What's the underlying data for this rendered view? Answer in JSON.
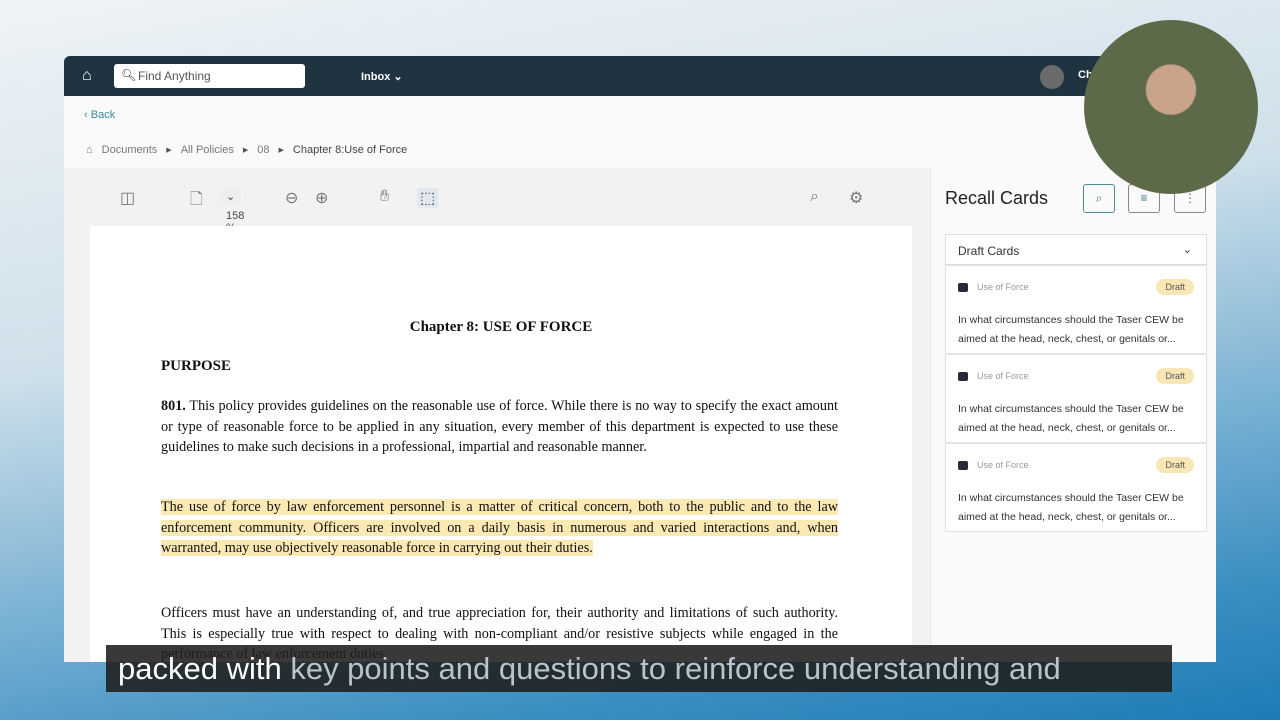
{
  "nav": {
    "search_placeholder": "Find Anything",
    "inbox": "Inbox",
    "user": "Ch"
  },
  "back": "Back",
  "breadcrumb": [
    "Documents",
    "All Policies",
    "08",
    "Chapter 8:Use of Force"
  ],
  "toolbar": {
    "zoom": "158 %"
  },
  "doc": {
    "title": "Chapter 8: USE OF FORCE",
    "heading": "PURPOSE",
    "p1_num": "801.",
    "p1": " This policy provides guidelines on the reasonable use of force. While there is no way to specify the exact amount or type of reasonable force to be applied in any situation, every member of this department is expected to use these guidelines to make such decisions in a professional, impartial and reasonable manner.",
    "p2": "The use of force by law enforcement personnel is a matter of critical concern, both to the public and to the law enforcement community. Officers are involved on a daily basis in numerous and varied interactions and, when warranted, may use objectively reasonable force in carrying out their duties.",
    "p3": "Officers must have an understanding of, and true appreciation for, their authority and limitations of such authority. This is especially true with respect to dealing with non-compliant and/or resistive subjects while engaged in the performance of law enforcement duties."
  },
  "side": {
    "title": "Recall Cards",
    "section": "Draft Cards",
    "cards": [
      {
        "tag": "Use of Force",
        "badge": "Draft",
        "q": "In what circumstances should the Taser CEW be aimed at the head, neck, chest, or genitals or..."
      },
      {
        "tag": "Use of Force",
        "badge": "Draft",
        "q": "In what circumstances should the Taser CEW be aimed at the head, neck, chest, or genitals or..."
      },
      {
        "tag": "Use of Force",
        "badge": "Draft",
        "q": "In what circumstances should the Taser CEW be aimed at the head, neck, chest, or genitals or..."
      }
    ]
  },
  "caption": {
    "spoken": "packed with",
    "upcoming": " key points and questions to reinforce understanding and"
  }
}
